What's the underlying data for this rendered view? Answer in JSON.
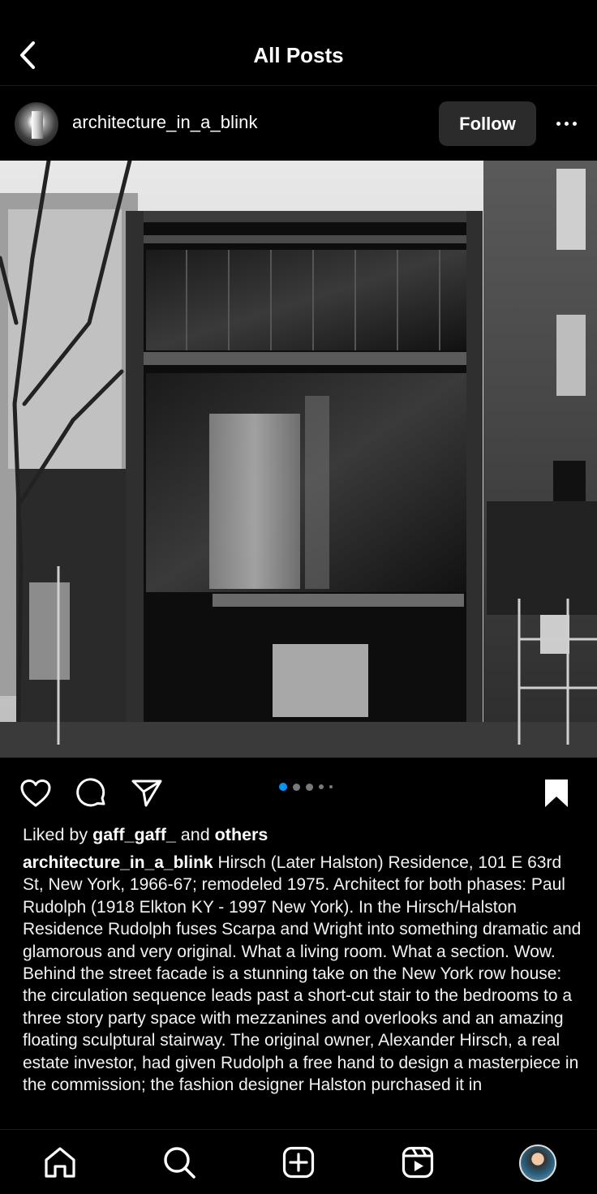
{
  "header": {
    "title": "All Posts"
  },
  "post": {
    "username": "architecture_in_a_blink",
    "follow_label": "Follow",
    "carousel_count": 5,
    "carousel_active": 1
  },
  "likes": {
    "prefix": "Liked by",
    "liker": "gaff_gaff_",
    "joiner": "and",
    "others": "others"
  },
  "caption": {
    "author": "architecture_in_a_blink",
    "text": "Hirsch (Later Halston) Residence, 101 E 63rd St, New York, 1966-67; remodeled 1975. Architect for both phases: Paul Rudolph (1918 Elkton KY - 1997 New York). In the Hirsch/Halston Residence Rudolph fuses Scarpa and Wright into something dramatic and glamorous and very original. What a living room. What a section. Wow. Behind the street facade is a stunning take on the New York row house: the circulation sequence leads past a short-cut stair to the bedrooms to a three story party space with mezzanines and overlooks and an amazing floating sculptural stairway. The original owner, Alexander Hirsch, a real estate investor, had given Rudolph a free hand to design a masterpiece in the commission; the fashion designer Halston purchased it in"
  },
  "icons": {
    "back": "chevron-left-icon",
    "more": "more-horizontal-icon",
    "like": "heart-icon",
    "comment": "comment-icon",
    "share": "send-icon",
    "save": "bookmark-icon",
    "home": "home-icon",
    "search": "search-icon",
    "create": "add-post-icon",
    "reels": "reels-icon",
    "profile": "profile-avatar"
  },
  "colors": {
    "background": "#000000",
    "follow_bg": "#2b2b2b",
    "carousel_active": "#0095f6",
    "carousel_inactive": "#7a7a7a"
  }
}
